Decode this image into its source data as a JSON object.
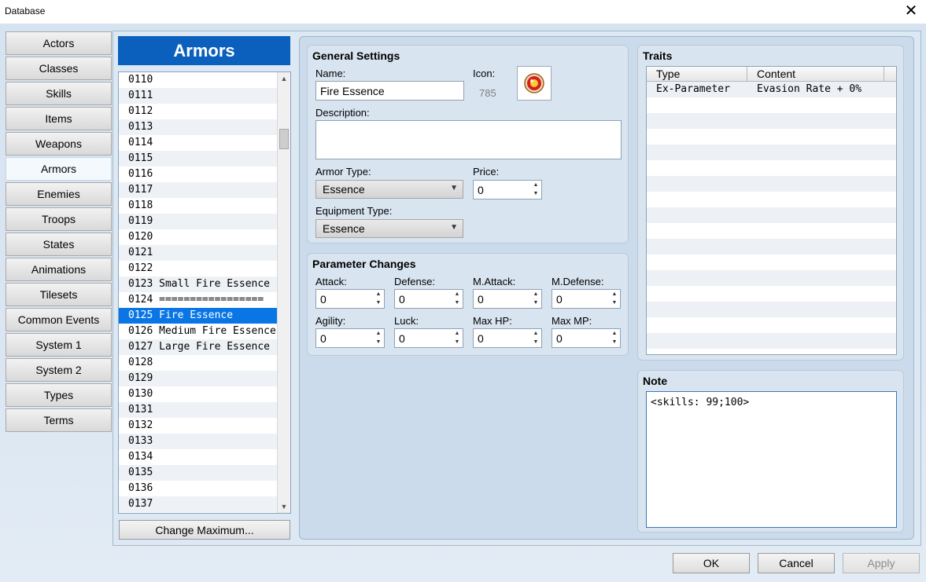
{
  "window": {
    "title": "Database",
    "close_glyph": "✕"
  },
  "categories": [
    {
      "label": "Actors",
      "active": false
    },
    {
      "label": "Classes",
      "active": false
    },
    {
      "label": "Skills",
      "active": false
    },
    {
      "label": "Items",
      "active": false
    },
    {
      "label": "Weapons",
      "active": false
    },
    {
      "label": "Armors",
      "active": true
    },
    {
      "label": "Enemies",
      "active": false
    },
    {
      "label": "Troops",
      "active": false
    },
    {
      "label": "States",
      "active": false
    },
    {
      "label": "Animations",
      "active": false
    },
    {
      "label": "Tilesets",
      "active": false
    },
    {
      "label": "Common Events",
      "active": false
    },
    {
      "label": "System 1",
      "active": false
    },
    {
      "label": "System 2",
      "active": false
    },
    {
      "label": "Types",
      "active": false
    },
    {
      "label": "Terms",
      "active": false
    }
  ],
  "armor_list": {
    "header": "Armors",
    "selected_index": 15,
    "items": [
      "0110",
      "0111",
      "0112",
      "0113",
      "0114",
      "0115",
      "0116",
      "0117",
      "0118",
      "0119",
      "0120",
      "0121",
      "0122",
      "0123 Small Fire Essence",
      "0124 =================",
      "0125 Fire Essence",
      "0126 Medium Fire Essence",
      "0127 Large Fire Essence",
      "0128",
      "0129",
      "0130",
      "0131",
      "0132",
      "0133",
      "0134",
      "0135",
      "0136",
      "0137"
    ],
    "change_max_label": "Change Maximum..."
  },
  "general": {
    "title": "General Settings",
    "name_label": "Name:",
    "name_value": "Fire Essence",
    "icon_label": "Icon:",
    "icon_index": "785",
    "description_label": "Description:",
    "description_value": "",
    "armor_type_label": "Armor Type:",
    "armor_type_value": "Essence",
    "price_label": "Price:",
    "price_value": "0",
    "equip_type_label": "Equipment Type:",
    "equip_type_value": "Essence"
  },
  "params": {
    "title": "Parameter Changes",
    "fields": [
      {
        "label": "Attack:",
        "value": "0"
      },
      {
        "label": "Defense:",
        "value": "0"
      },
      {
        "label": "M.Attack:",
        "value": "0"
      },
      {
        "label": "M.Defense:",
        "value": "0"
      },
      {
        "label": "Agility:",
        "value": "0"
      },
      {
        "label": "Luck:",
        "value": "0"
      },
      {
        "label": "Max HP:",
        "value": "0"
      },
      {
        "label": "Max MP:",
        "value": "0"
      }
    ]
  },
  "traits": {
    "title": "Traits",
    "col_type": "Type",
    "col_content": "Content",
    "rows": [
      {
        "type": "Ex-Parameter",
        "content": "Evasion Rate + 0%"
      }
    ],
    "empty_rows": 17
  },
  "note": {
    "title": "Note",
    "value": "<skills: 99;100>"
  },
  "buttons": {
    "ok": "OK",
    "cancel": "Cancel",
    "apply": "Apply"
  }
}
